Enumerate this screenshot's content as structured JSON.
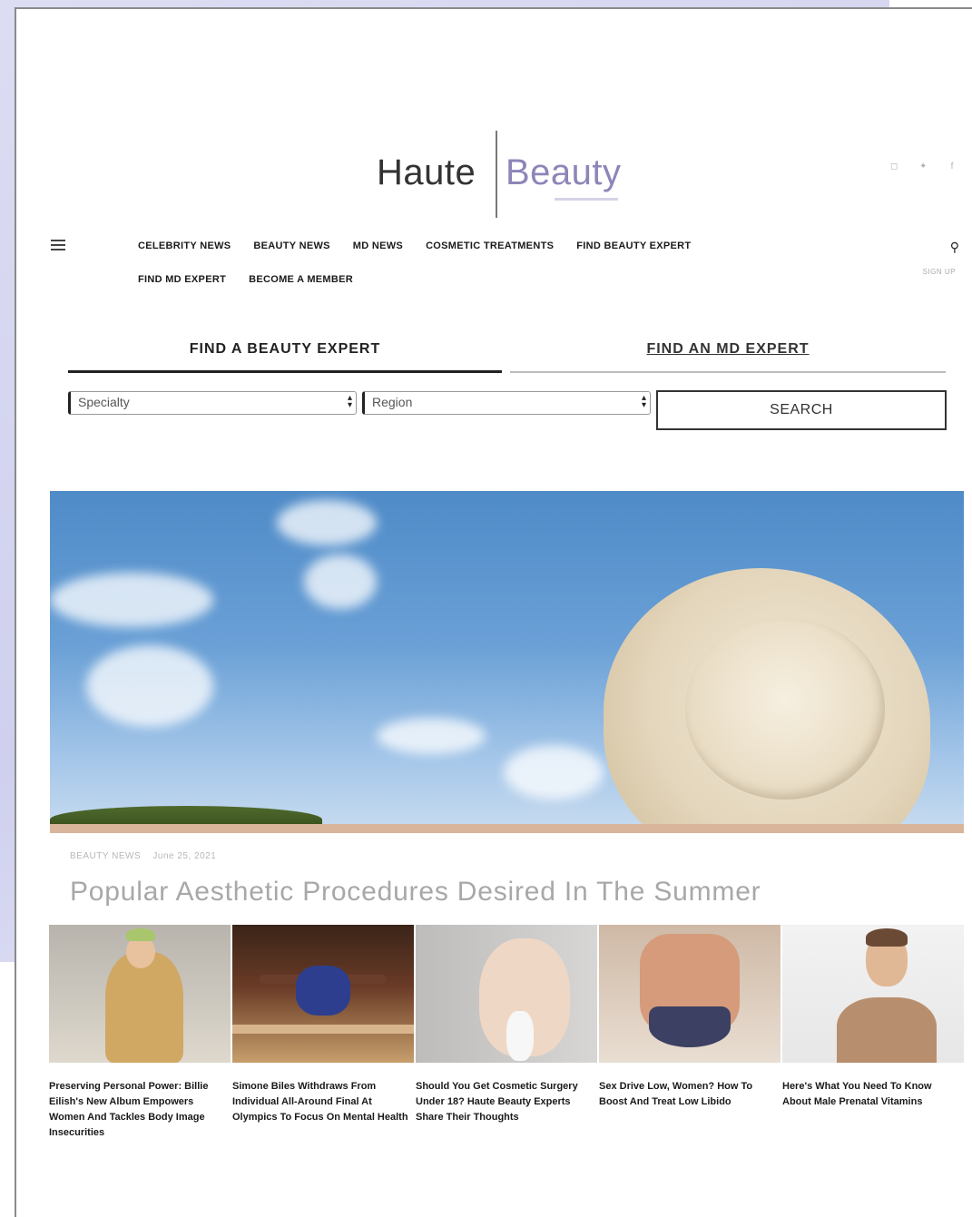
{
  "header": {
    "logo_word1": "Haute",
    "logo_word2": "Beauty",
    "social_icons": [
      "instagram-icon",
      "twitter-icon",
      "facebook-icon"
    ],
    "sign_up": "SIGN UP"
  },
  "nav": {
    "row1": [
      "CELEBRITY NEWS",
      "BEAUTY NEWS",
      "MD NEWS",
      "COSMETIC TREATMENTS",
      "FIND BEAUTY EXPERT"
    ],
    "row2": [
      "FIND MD EXPERT",
      "BECOME A MEMBER"
    ]
  },
  "finder": {
    "tab_beauty": "FIND A BEAUTY EXPERT",
    "tab_md": "FIND AN MD EXPERT",
    "specialty_placeholder": "Specialty",
    "region_placeholder": "Region",
    "search_label": "SEARCH"
  },
  "hero": {
    "category": "BEAUTY NEWS",
    "date": "June 25, 2021",
    "headline": "Popular Aesthetic Procedures Desired In The Summer"
  },
  "articles": [
    {
      "title": "Preserving Personal Power: Billie Eilish's New Album Empowers Women And Tackles Body Image Insecurities"
    },
    {
      "title": "Simone Biles Withdraws From Individual All-Around Final At Olympics To Focus On Mental Health"
    },
    {
      "title": "Should You Get Cosmetic Surgery Under 18? Haute Beauty Experts Share Their Thoughts"
    },
    {
      "title": "Sex Drive Low, Women? How To Boost And Treat Low Libido"
    },
    {
      "title": "Here's What You Need To Know About Male Prenatal Vitamins"
    }
  ],
  "colors": {
    "logo_accent": "#8c86b8",
    "headline": "#a8a8a8",
    "background_shape": "#cfd0ee"
  }
}
